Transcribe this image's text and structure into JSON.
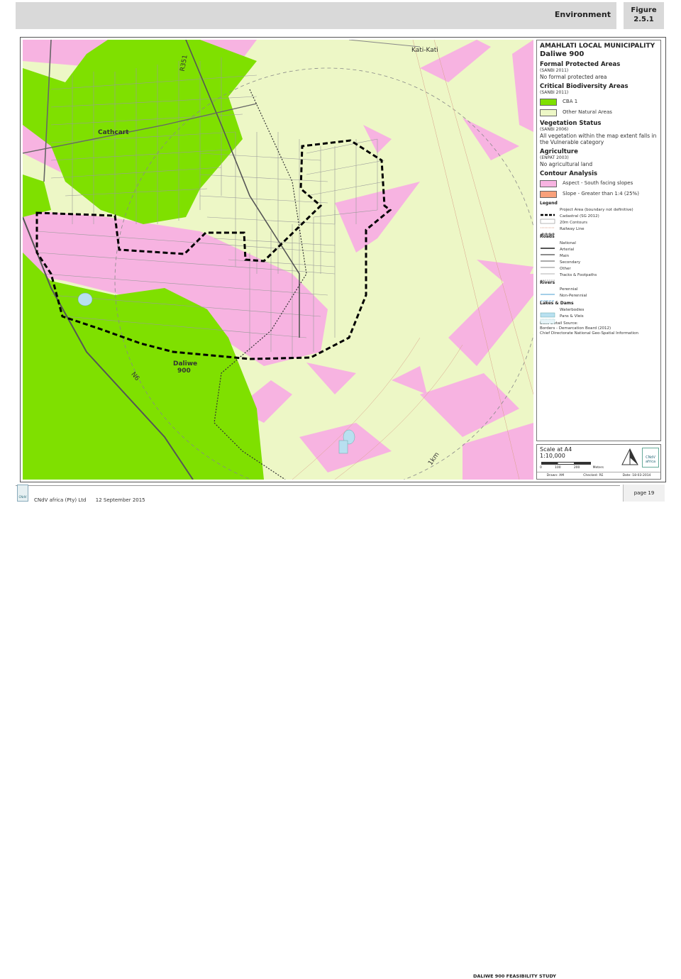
{
  "header": {
    "title": "Environment",
    "figure_label": "Figure",
    "figure_number": "2.5.1"
  },
  "map": {
    "labels": {
      "kati_kati": "Kati-Kati",
      "road_r351": "R351",
      "cathcart": "Cathcart",
      "daliwe_line1": "Daliwe",
      "daliwe_line2": "900",
      "n6": "N6",
      "contour_1km": "1km"
    }
  },
  "legend": {
    "municipality": "AMAHLATI LOCAL MUNICIPALITY",
    "project": "Daliwe 900",
    "protected": {
      "heading": "Formal Protected Areas",
      "source": "(SANBI 2011)",
      "text": "No formal protected area"
    },
    "biodiversity": {
      "heading": "Critical Biodiversity Areas",
      "source": "(SANBI 2011)",
      "items": [
        {
          "label": "CBA 1",
          "color": "#7fe000"
        },
        {
          "label": "Other Natural Areas",
          "color": "#edf7c6"
        }
      ]
    },
    "vegetation": {
      "heading": "Vegetation Status",
      "source": "(SANBI 2006)",
      "text": "All vegetation within the map extent falls in the Vulnerable category"
    },
    "agriculture": {
      "heading": "Agriculture",
      "source": "(ENPAT 2003)",
      "text": "No agricultural land"
    },
    "contour": {
      "heading": "Contour Analysis",
      "items": [
        {
          "label": "Aspect - South facing slopes",
          "color": "#f7b3e1"
        },
        {
          "label": "Slope - Greater than 1:4 (25%)",
          "color": "#f9a07a"
        }
      ]
    },
    "symbols": {
      "heading": "Legend",
      "items": [
        {
          "label": "Project Area (boundary not definitive)",
          "style": "dashed-thick"
        },
        {
          "label": "Cadastral (SG 2012)",
          "style": "box"
        },
        {
          "label": "20m Contours",
          "style": "dotted-orange"
        },
        {
          "label": "Railway Line",
          "style": "rail"
        }
      ]
    },
    "roads": {
      "heading": "Roads",
      "items": [
        {
          "label": "National",
          "style": "road-national"
        },
        {
          "label": "Arterial",
          "style": "road-arterial"
        },
        {
          "label": "Main",
          "style": "road-main"
        },
        {
          "label": "Secondary",
          "style": "road-secondary"
        },
        {
          "label": "Other",
          "style": "road-other"
        },
        {
          "label": "Tracks & Footpaths",
          "style": "road-tracks"
        }
      ]
    },
    "rivers": {
      "heading": "Rivers",
      "items": [
        {
          "label": "Perennial",
          "style": "river-perennial"
        },
        {
          "label": "Non-Perennial",
          "style": "river-nonperennial"
        }
      ]
    },
    "lakes": {
      "heading": "Lakes & Dams",
      "items": [
        {
          "label": "Waterbodies",
          "style": "water"
        },
        {
          "label": "Pans & Vleis",
          "style": "pans"
        }
      ]
    },
    "source": {
      "heading": "Base Detail Source:",
      "line1": "Borders - Demarcation Board (2012)",
      "line2": "Chief Directorate National Geo-Spatial Information"
    }
  },
  "scale": {
    "label": "Scale at A4",
    "ratio": "1:10,000",
    "ticks": [
      "0",
      "100",
      "200"
    ],
    "unit": "Meters",
    "drawn": "Drawn: AM",
    "checked": "Checked: RE",
    "date": "Date: 18-03-2014",
    "logo_text": "CNdV africa"
  },
  "footer": {
    "company": "CNdV africa (Pty) Ltd",
    "date": "12 September 2015",
    "study": "DALIWE 900 FEASIBILITY STUDY",
    "page": "page 19",
    "logo_text": "CNdV"
  }
}
